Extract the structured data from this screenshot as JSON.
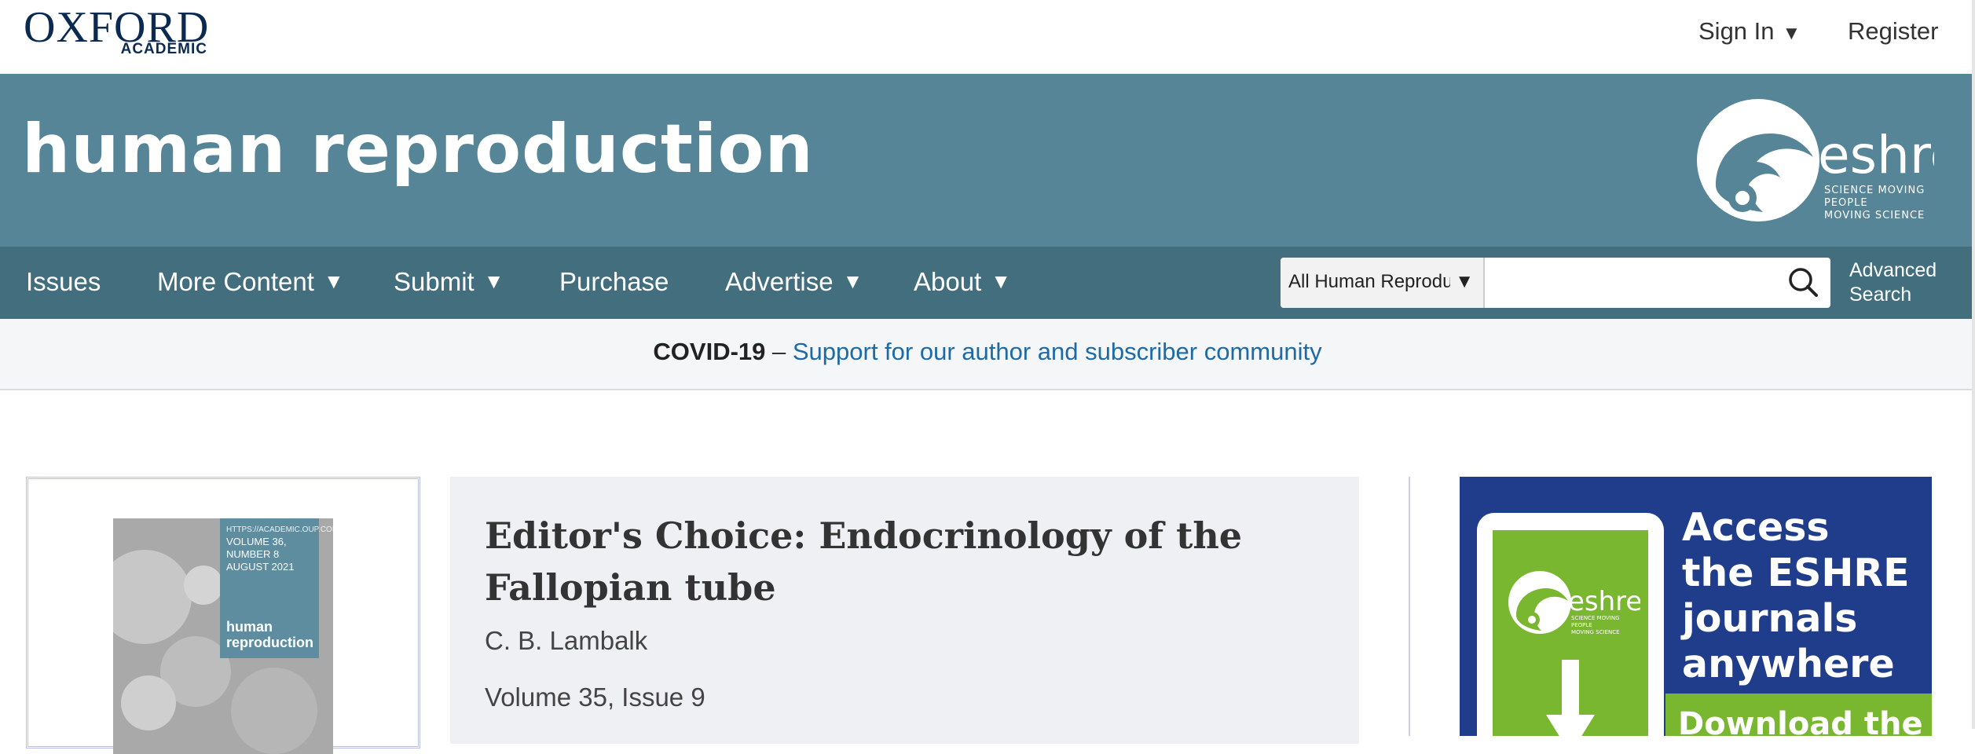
{
  "header": {
    "logo_main": "OXFORD",
    "logo_sub": "ACADEMIC",
    "sign_in_label": "Sign In",
    "register_label": "Register"
  },
  "banner": {
    "journal_title": "human reproduction",
    "society_logo": {
      "name": "eshre",
      "tagline_1": "SCIENCE MOVING",
      "tagline_2": "PEOPLE",
      "tagline_3": "MOVING SCIENCE"
    }
  },
  "nav": {
    "items": [
      {
        "label": "Issues",
        "has_dropdown": false
      },
      {
        "label": "More Content",
        "has_dropdown": true
      },
      {
        "label": "Submit",
        "has_dropdown": true
      },
      {
        "label": "Purchase",
        "has_dropdown": false
      },
      {
        "label": "Advertise",
        "has_dropdown": true
      },
      {
        "label": "About",
        "has_dropdown": true
      }
    ],
    "search": {
      "scope_selected": "All Human Reproduction",
      "query_value": "",
      "icon": "search-icon"
    },
    "advanced_search_line1": "Advanced",
    "advanced_search_line2": "Search"
  },
  "notice": {
    "bold_text": "COVID-19",
    "separator": " – ",
    "link_text": "Support for our author and subscriber community"
  },
  "featured": {
    "cover": {
      "meta": "HTTPS://ACADEMIC.OUP.COM/HUMREP",
      "volume_line1": "VOLUME 36, NUMBER 8",
      "volume_line2": "AUGUST 2021",
      "title_line1": "human",
      "title_line2": "reproduction"
    },
    "title": "Editor's Choice: Endocrinology of the Fallopian tube",
    "author": "C. B. Lambalk",
    "volume_issue": "Volume 35, Issue 9"
  },
  "ad": {
    "headline_1": "Access",
    "headline_2": "the ESHRE",
    "headline_3": "journals",
    "headline_4": "anywhere",
    "cta": "Download the",
    "logo_name": "eshre",
    "logo_tagline_1": "SCIENCE MOVING",
    "logo_tagline_2": "PEOPLE",
    "logo_tagline_3": "MOVING SCIENCE"
  },
  "colors": {
    "brand_navy": "#0b2a52",
    "banner_teal": "#558596",
    "nav_teal": "#426e7e",
    "link_blue": "#1d6aa5",
    "ad_blue": "#1f3d8a",
    "ad_green": "#7ab730"
  }
}
